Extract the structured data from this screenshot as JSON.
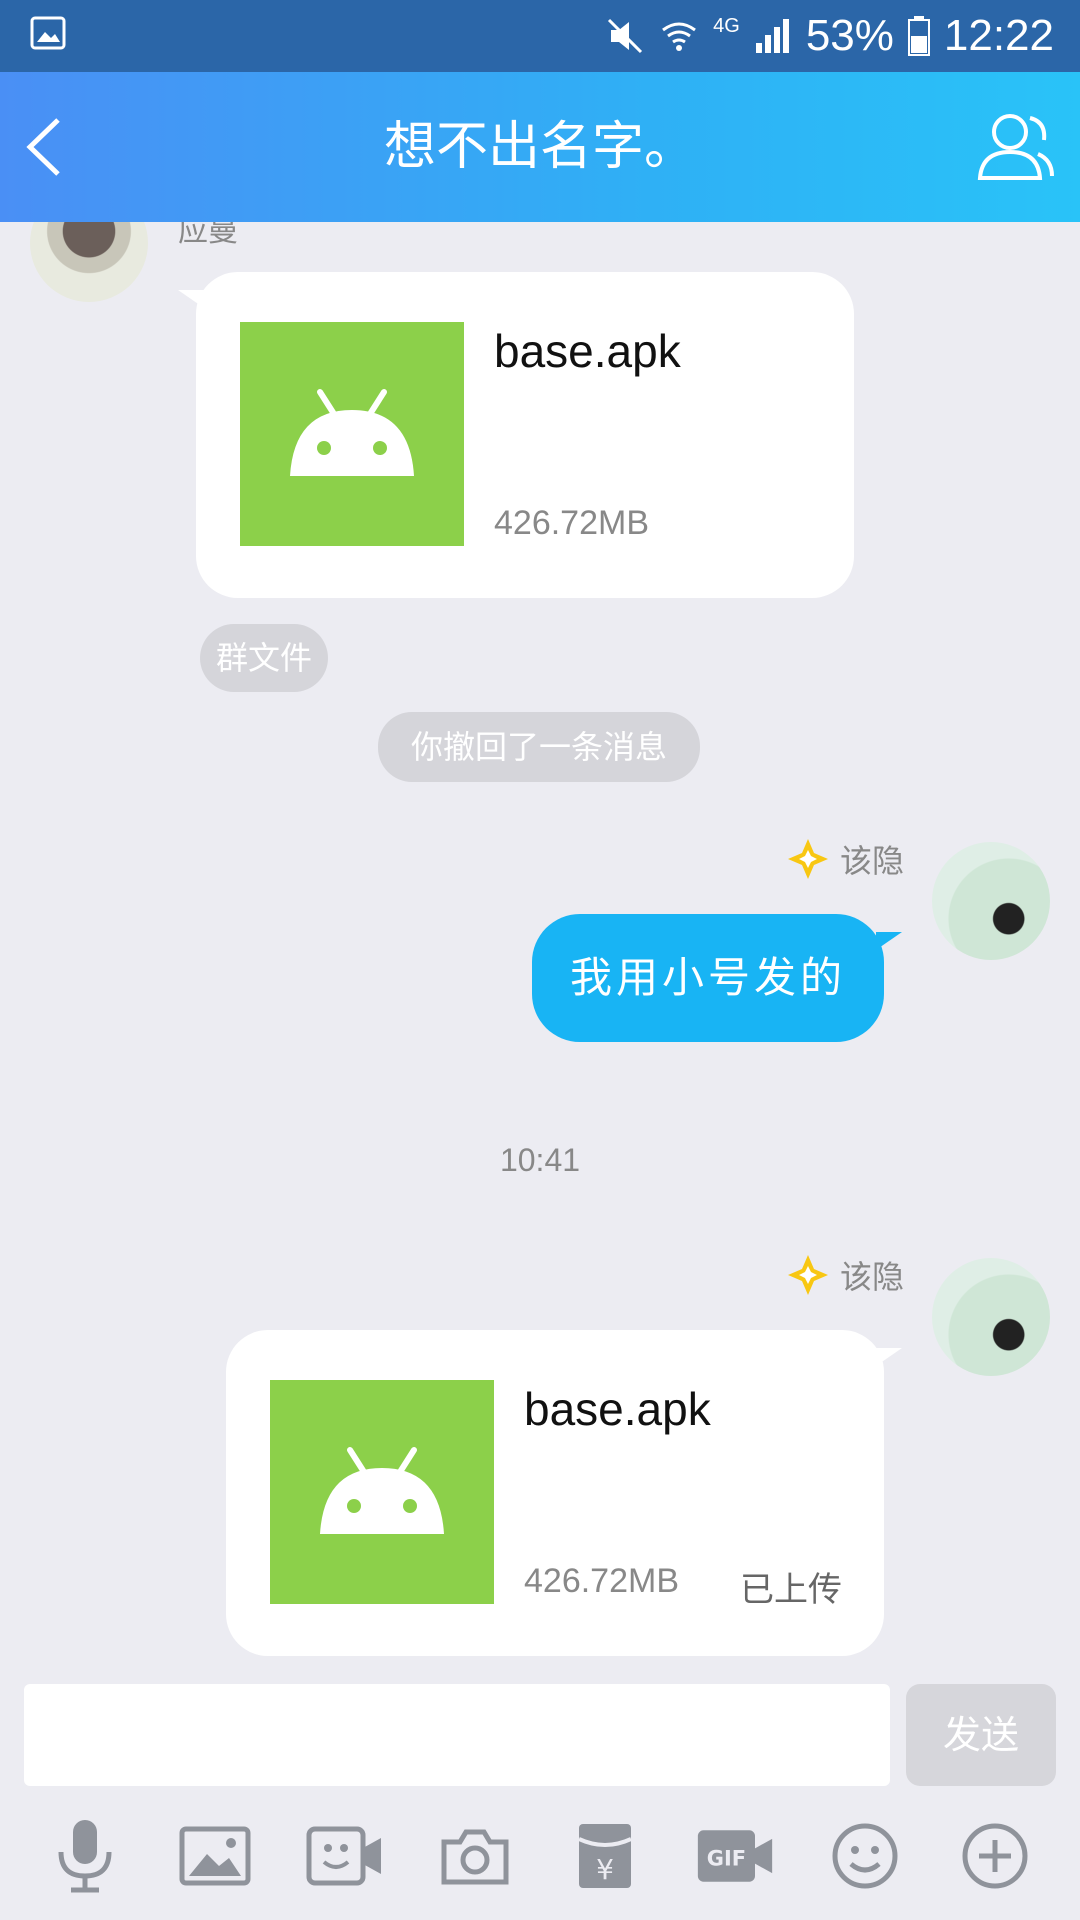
{
  "status_bar": {
    "battery": "53%",
    "time": "12:22",
    "network": "4G"
  },
  "header": {
    "title": "想不出名字。"
  },
  "messages": {
    "incoming_sender": "应曼",
    "file1": {
      "name": "base.apk",
      "size": "426.72MB"
    },
    "group_file_tag": "群文件",
    "recall_notice": "你撤回了一条消息",
    "outgoing_sender": "该隐",
    "outgoing_text": "我用小号发的",
    "time": "10:41",
    "file2": {
      "name": "base.apk",
      "size": "426.72MB",
      "status": "已上传"
    }
  },
  "input": {
    "placeholder": "",
    "send_label": "发送"
  },
  "toolbar": [
    "mic-icon",
    "image-icon",
    "video-icon",
    "camera-icon",
    "red-packet-icon",
    "gif-icon",
    "emoji-icon",
    "plus-icon"
  ],
  "colors": {
    "title_gradient_start": "#4A8FF5",
    "title_gradient_end": "#29C3F8",
    "bubble_blue": "#18B4F4",
    "android_green": "#8CD04A"
  }
}
